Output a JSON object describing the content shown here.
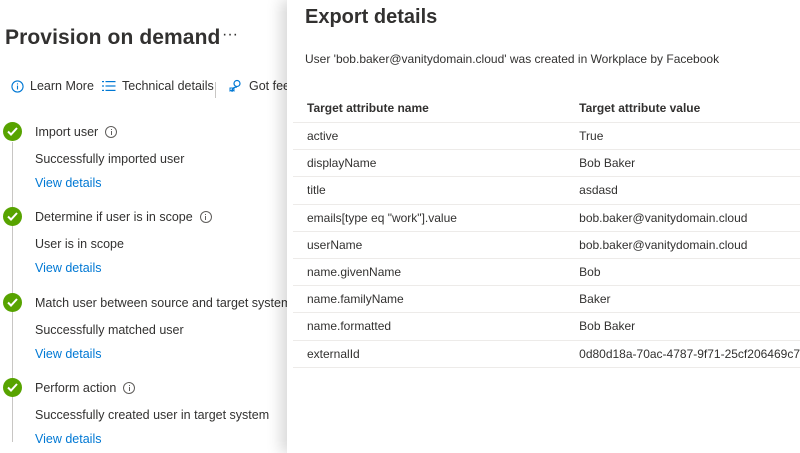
{
  "page": {
    "title": "Provision on demand",
    "more_label": "···"
  },
  "toolbar": {
    "learn_more": "Learn More",
    "technical_details": "Technical details",
    "feedback": "Got feedback?"
  },
  "steps": [
    {
      "title": "Import user",
      "description": "Successfully imported user",
      "link": "View details"
    },
    {
      "title": "Determine if user is in scope",
      "description": "User is in scope",
      "link": "View details"
    },
    {
      "title": "Match user between source and target system",
      "description": "Successfully matched user",
      "link": "View details"
    },
    {
      "title": "Perform action",
      "description": "Successfully created user in target system",
      "link": "View details"
    }
  ],
  "panel": {
    "title": "Export details",
    "message": "User 'bob.baker@vanitydomain.cloud' was created in Workplace by Facebook",
    "columns": [
      "Target attribute name",
      "Target attribute value"
    ],
    "rows": [
      {
        "name": "active",
        "value": "True"
      },
      {
        "name": "displayName",
        "value": "Bob Baker"
      },
      {
        "name": "title",
        "value": "asdasd"
      },
      {
        "name": "emails[type eq \"work\"].value",
        "value": "bob.baker@vanitydomain.cloud"
      },
      {
        "name": "userName",
        "value": "bob.baker@vanitydomain.cloud"
      },
      {
        "name": "name.givenName",
        "value": "Bob"
      },
      {
        "name": "name.familyName",
        "value": "Baker"
      },
      {
        "name": "name.formatted",
        "value": "Bob Baker"
      },
      {
        "name": "externalId",
        "value": "0d80d18a-70ac-4787-9f71-25cf206469c7"
      }
    ]
  },
  "colors": {
    "accent": "#0078d4",
    "success": "#57a300",
    "text": "#323130"
  }
}
